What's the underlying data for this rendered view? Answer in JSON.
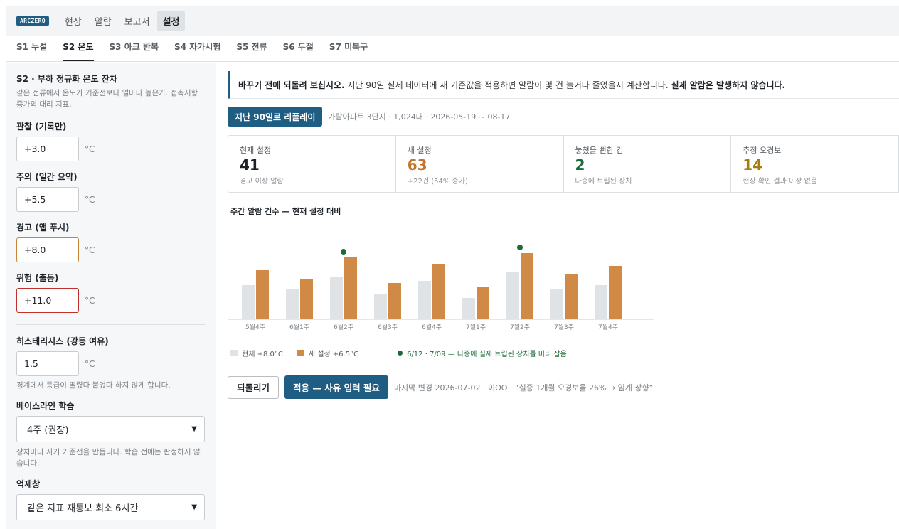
{
  "app": {
    "logo": "ARCZERO",
    "nav": [
      "현장",
      "알람",
      "보고서",
      "설정"
    ],
    "active_nav": "설정"
  },
  "subtabs": [
    "S1 누설",
    "S2 온도",
    "S3 아크 반복",
    "S4 자가시험",
    "S5 전류",
    "S6 두절",
    "S7 미복구"
  ],
  "sidebar": {
    "title": "S2 · 부하 정규화 온도 잔차",
    "desc": "같은 전류에서 온도가 기준선보다 얼마나 높은가. 접촉저항 증가의 대리 지표.",
    "levels": [
      {
        "label": "관찰 (기록만)",
        "value": "+3.0",
        "unit": "°C",
        "state": "normal"
      },
      {
        "label": "주의 (일간 요약)",
        "value": "+5.5",
        "unit": "°C",
        "state": "normal"
      },
      {
        "label": "경고 (앱 푸시)",
        "value": "+8.0",
        "unit": "°C",
        "state": "warn"
      },
      {
        "label": "위험 (출동)",
        "value": "+11.0",
        "unit": "°C",
        "state": "danger"
      }
    ],
    "hysteresis": {
      "label": "히스테리시스 (강등 여유)",
      "value": "1.5",
      "unit": "°C",
      "hint": "경계에서 등급이 떨렸다 붙었다 하지 않게 합니다."
    },
    "baseline": {
      "label": "베이스라인 학습",
      "value": "4주 (권장)",
      "hint": "장치마다 자기 기준선을 만듭니다. 학습 전에는 판정하지 않습니다."
    },
    "suppression": {
      "label": "억제창",
      "value": "같은 지표 재통보 최소 6시간"
    }
  },
  "main": {
    "notice_bold": "바꾸기 전에 되돌려 보십시오.",
    "notice_text": " 지난 90일 실제 데이터에 새 기준값을 적용하면 알람이 몇 건 늘거나 줄었을지 계산합니다. ",
    "notice_bold2": "실제 알람은 발생하지 않습니다.",
    "replay_button": "지난 90일로 리플레이",
    "replay_meta": "가람아파트 3단지 · 1,024대 · 2026-05-19 ~ 08-17",
    "stats": [
      {
        "label": "현재 설정",
        "value": "41",
        "sub": "경고 이상 알람",
        "color": "#1f2328"
      },
      {
        "label": "새 설정",
        "value": "63",
        "sub": "+22건 (54% 증가)",
        "color": "#c2742a"
      },
      {
        "label": "놓쳤을 뻔한 건",
        "value": "2",
        "sub": "나중에 트립된 장치",
        "color": "#1e6b3a"
      },
      {
        "label": "추정 오경보",
        "value": "14",
        "sub": "현장 확인 결과 이상 없음",
        "color": "#a57d0d"
      }
    ],
    "chart_title": "주간 알람 건수 — 현재 설정 대비",
    "legend": {
      "current": "현재 +8.0°C",
      "new": "새 설정 +6.5°C",
      "event": "6/12 · 7/09 — 나중에 실제 트립된 장치를 미리 잡음"
    },
    "revert_button": "되돌리기",
    "apply_button": "적용 — 사유 입력 필요",
    "last_change": "마지막 변경 2026-07-02 · 이OO · “실증 1개월 오경보율 26% → 임계 상향”"
  },
  "chart_data": {
    "type": "bar",
    "title": "주간 알람 건수 — 현재 설정 대비",
    "categories": [
      "5월4주",
      "6월1주",
      "6월2주",
      "6월3주",
      "6월4주",
      "7월1주",
      "7월2주",
      "7월3주",
      "7월4주"
    ],
    "series": [
      {
        "name": "현재 +8.0°C",
        "values": [
          32,
          28,
          40,
          24,
          36,
          20,
          44,
          28,
          32
        ],
        "color": "#dfe3e6"
      },
      {
        "name": "새 설정 +6.5°C",
        "values": [
          46,
          38,
          58,
          34,
          52,
          30,
          62,
          42,
          50
        ],
        "color": "#d08a45"
      }
    ],
    "markers": [
      {
        "category": "6월2주",
        "label": "6/12"
      },
      {
        "category": "7월2주",
        "label": "7/09"
      }
    ],
    "marker_color": "#1e6b3a",
    "ylim": [
      0,
      80
    ],
    "grid": false,
    "legend": "bottom-left"
  }
}
